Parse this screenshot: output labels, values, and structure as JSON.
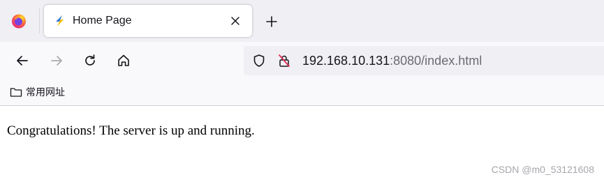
{
  "tabstrip": {
    "app_icon": "firefox-icon",
    "tab": {
      "title": "Home Page",
      "favicon": "lightning-favicon-icon",
      "close_icon": "close-icon"
    },
    "new_tab_icon": "plus-icon"
  },
  "navbar": {
    "back_icon": "back-arrow-icon",
    "forward_icon": "forward-arrow-icon",
    "reload_icon": "reload-icon",
    "home_icon": "home-icon",
    "url": {
      "host": "192.168.10.131",
      "rest": ":8080/index.html"
    },
    "security_icons": [
      "shield-icon",
      "insecure-lock-icon"
    ]
  },
  "bookmarks": {
    "items": [
      {
        "label": "常用网址",
        "icon": "folder-icon"
      }
    ]
  },
  "content": {
    "message": "Congratulations! The server is up and running."
  },
  "watermark": "CSDN @m0_53121608",
  "colors": {
    "tabstrip_bg": "#f0f0f4",
    "toolbar_bg": "#f9f9fb",
    "urlbar_bg": "#f0f0f4",
    "insecure_red": "#e22850"
  }
}
